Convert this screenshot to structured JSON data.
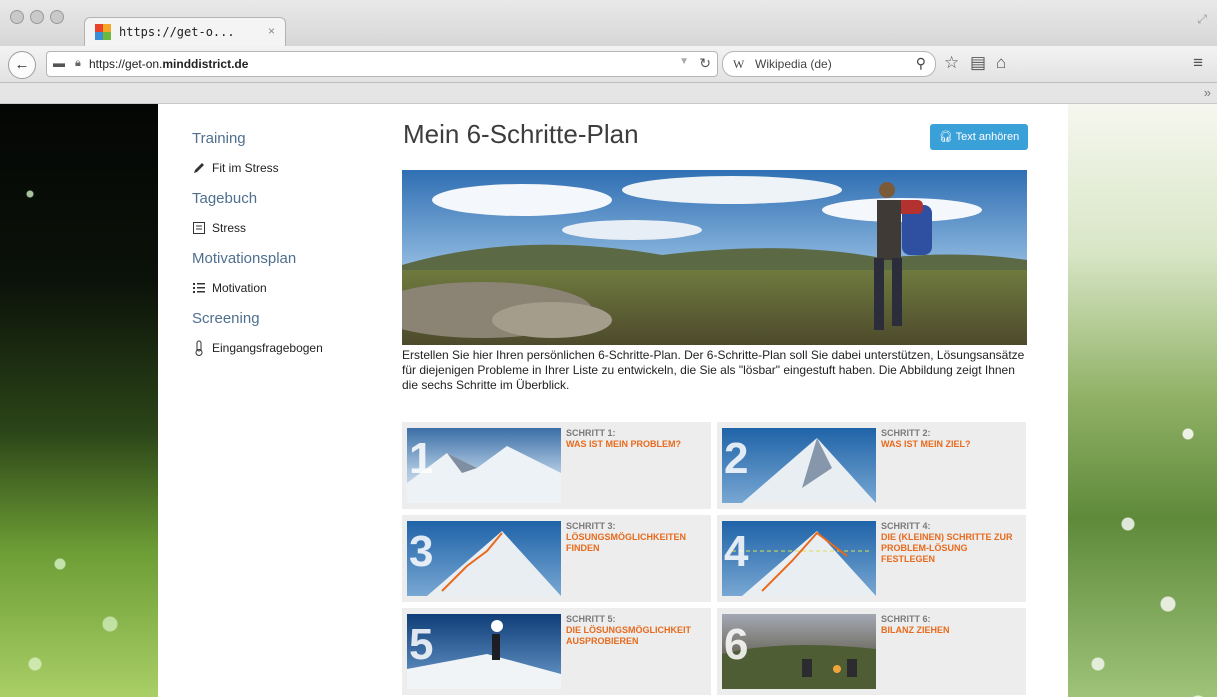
{
  "browser": {
    "tab_title": "https://get-o...",
    "tab_close": "×",
    "url_prefix": "https://get-on.",
    "url_domain": "minddistrict.de",
    "search_engine_icon": "W",
    "search_placeholder": "Wikipedia (de)",
    "back_icon": "←",
    "overflow_icon": "»"
  },
  "sidebar": {
    "sections": [
      {
        "heading": "Training",
        "item": "Fit im Stress",
        "icon": "pencil-icon"
      },
      {
        "heading": "Tagebuch",
        "item": "Stress",
        "icon": "diary-icon"
      },
      {
        "heading": "Motivationsplan",
        "item": "Motivation",
        "icon": "list-icon"
      },
      {
        "heading": "Screening",
        "item": "Eingangsfragebogen",
        "icon": "thermometer-icon"
      }
    ]
  },
  "main": {
    "title": "Mein 6-Schritte-Plan",
    "listen_button": "Text anhören",
    "intro": "Erstellen Sie hier Ihren persönlichen 6-Schritte-Plan. Der 6-Schritte-Plan soll Sie dabei unterstützen, Lösungsansätze für diejenigen Probleme in Ihrer Liste zu entwickeln, die Sie als \"lösbar\" eingestuft haben. Die Abbildung zeigt Ihnen die sechs Schritte im Überblick.",
    "steps": [
      {
        "num": "1",
        "label": "SCHRITT 1:",
        "title": "WAS IST MEIN PROBLEM?"
      },
      {
        "num": "2",
        "label": "SCHRITT 2:",
        "title": "WAS IST MEIN ZIEL?"
      },
      {
        "num": "3",
        "label": "SCHRITT 3:",
        "title": "LÖSUNGSMÖGLICHKEITEN FINDEN"
      },
      {
        "num": "4",
        "label": "SCHRITT 4:",
        "title": "DIE (KLEINEN) SCHRITTE ZUR PROBLEM-LÖSUNG FESTLEGEN"
      },
      {
        "num": "5",
        "label": "SCHRITT 5:",
        "title": "DIE LÖSUNGSMÖGLICHKEIT AUSPROBIEREN"
      },
      {
        "num": "6",
        "label": "SCHRITT 6:",
        "title": "BILANZ ZIEHEN"
      }
    ]
  },
  "colors": {
    "accent": "#3aa0d8",
    "step_title": "#e86a1d",
    "heading": "#4f6f8f"
  }
}
